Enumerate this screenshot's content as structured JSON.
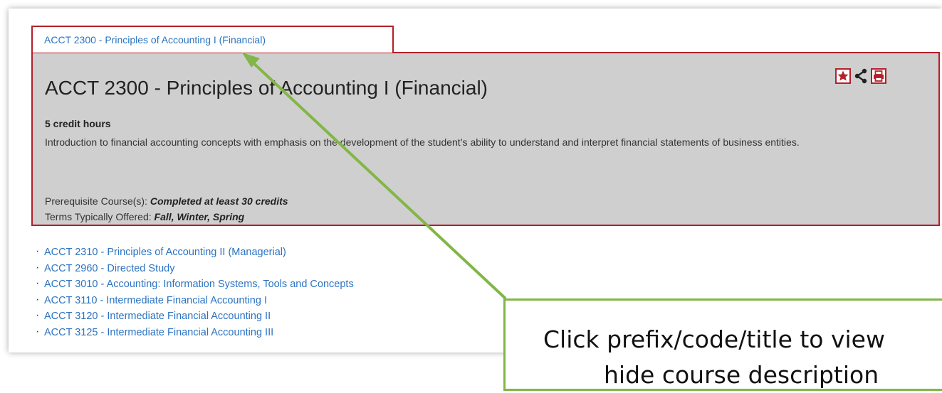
{
  "tab": {
    "label": "ACCT 2300 - Principles of Accounting I (Financial)"
  },
  "course": {
    "title": "ACCT 2300 - Principles of Accounting I (Financial)",
    "credits": "5 credit hours",
    "description": "Introduction to financial accounting concepts with emphasis on the development of the student’s ability to understand and interpret financial statements of business entities.",
    "prereq_label": "Prerequisite Course(s): ",
    "prereq_value": "Completed at least 30 credits",
    "terms_label": "Terms Typically Offered: ",
    "terms_value": "Fall, Winter, Spring"
  },
  "actions": {
    "favorite": "star-icon",
    "share": "share-icon",
    "print": "print-icon"
  },
  "course_list": [
    "ACCT 2310 - Principles of Accounting II (Managerial)",
    "ACCT 2960 - Directed Study",
    "ACCT 3010 - Accounting: Information Systems, Tools and Concepts",
    "ACCT 3110 - Intermediate Financial Accounting I",
    "ACCT 3120 - Intermediate Financial Accounting II",
    "ACCT 3125 - Intermediate Financial Accounting III"
  ],
  "callout": {
    "line1": "Click prefix/code/title to view",
    "line2": "hide course description"
  },
  "colors": {
    "accent_red": "#b3202a",
    "link_blue": "#2b73c2",
    "panel_gray": "#cfcfcf",
    "arrow_green": "#82b646"
  }
}
